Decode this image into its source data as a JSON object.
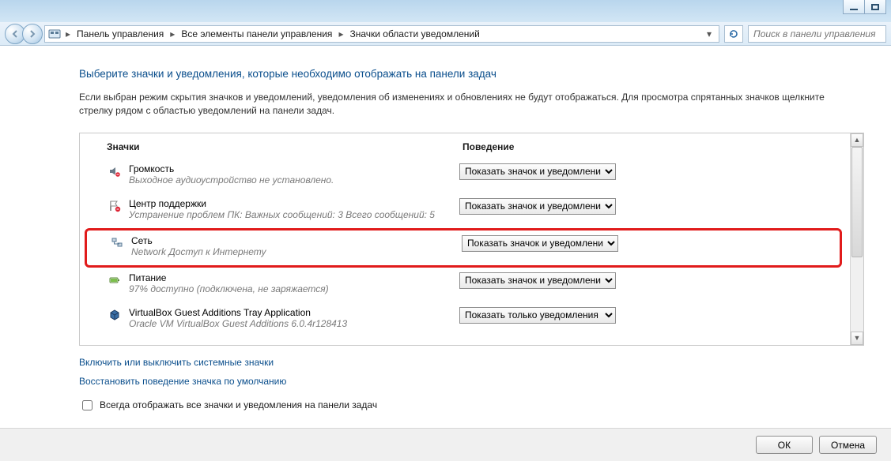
{
  "titlebar": {
    "minimize": "minimize",
    "maximize": "maximize"
  },
  "breadcrumb": {
    "parts": [
      "Панель управления",
      "Все элементы панели управления",
      "Значки области уведомлений"
    ]
  },
  "search": {
    "placeholder": "Поиск в панели управления"
  },
  "heading": "Выберите значки и уведомления, которые необходимо отображать на панели задач",
  "description": "Если выбран режим скрытия значков и уведомлений, уведомления об изменениях и обновлениях не будут отображаться. Для просмотра спрятанных значков щелкните стрелку рядом с областью уведомлений на панели задач.",
  "columns": {
    "icons": "Значки",
    "behavior": "Поведение"
  },
  "behavior_options": {
    "show_icon": "Показать значок и уведомлени",
    "show_notify": "Показать только уведомления"
  },
  "items": [
    {
      "title": "Громкость",
      "sub": "Выходное аудиоустройство не установлено.",
      "behavior": "show_icon",
      "icon": "volume"
    },
    {
      "title": "Центр поддержки",
      "sub": "Устранение проблем ПК: Важных сообщений: 3  Всего сообщений: 5",
      "behavior": "show_icon",
      "icon": "flag"
    },
    {
      "title": "Сеть",
      "sub": "Network Доступ к Интернету",
      "behavior": "show_icon",
      "icon": "network",
      "highlight": true
    },
    {
      "title": "Питание",
      "sub": "97% доступно (подключена, не заряжается)",
      "behavior": "show_icon",
      "icon": "power"
    },
    {
      "title": "VirtualBox Guest Additions Tray Application",
      "sub": "Oracle VM VirtualBox Guest Additions 6.0.4r128413",
      "behavior": "show_notify",
      "icon": "cube"
    }
  ],
  "links": {
    "toggle_system": "Включить или выключить системные значки",
    "restore_default": "Восстановить поведение значка по умолчанию"
  },
  "checkbox_label": "Всегда отображать все значки и уведомления на панели задач",
  "footer": {
    "ok": "ОК",
    "cancel": "Отмена"
  }
}
